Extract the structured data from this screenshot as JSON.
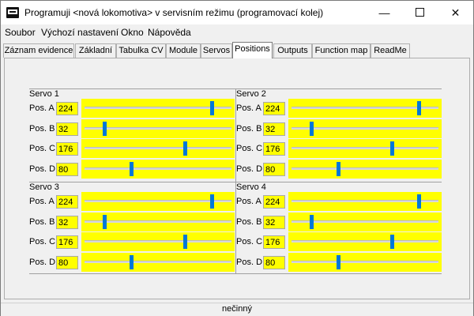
{
  "window": {
    "title": "Programuji <nová lokomotiva> v servisním režimu (programovací kolej)",
    "minimize": "—",
    "close": "✕"
  },
  "menu": [
    "Soubor",
    "Výchozí nastavení",
    "Okno",
    "Nápověda"
  ],
  "tabs": [
    "Záznam evidence",
    "Základní",
    "Tabulka CV",
    "Module",
    "Servos",
    "Positions",
    "Outputs",
    "Function map",
    "ReadMe"
  ],
  "active_tab": "Positions",
  "slider_max": 255,
  "groups": [
    {
      "title": "Servo 1",
      "positions": [
        {
          "label": "Pos. A",
          "value": "224"
        },
        {
          "label": "Pos. B",
          "value": "32"
        },
        {
          "label": "Pos. C",
          "value": "176"
        },
        {
          "label": "Pos. D",
          "value": "80"
        }
      ]
    },
    {
      "title": "Servo 2",
      "positions": [
        {
          "label": "Pos. A",
          "value": "224"
        },
        {
          "label": "Pos. B",
          "value": "32"
        },
        {
          "label": "Pos. C",
          "value": "176"
        },
        {
          "label": "Pos. D",
          "value": "80"
        }
      ]
    },
    {
      "title": "Servo 3",
      "positions": [
        {
          "label": "Pos. A",
          "value": "224"
        },
        {
          "label": "Pos. B",
          "value": "32"
        },
        {
          "label": "Pos. C",
          "value": "176"
        },
        {
          "label": "Pos. D",
          "value": "80"
        }
      ]
    },
    {
      "title": "Servo 4",
      "positions": [
        {
          "label": "Pos. A",
          "value": "224"
        },
        {
          "label": "Pos. B",
          "value": "32"
        },
        {
          "label": "Pos. C",
          "value": "176"
        },
        {
          "label": "Pos. D",
          "value": "80"
        }
      ]
    }
  ],
  "colors": {
    "highlight": "#ffff00",
    "slider_thumb": "#0078d7"
  },
  "status": "nečinný"
}
